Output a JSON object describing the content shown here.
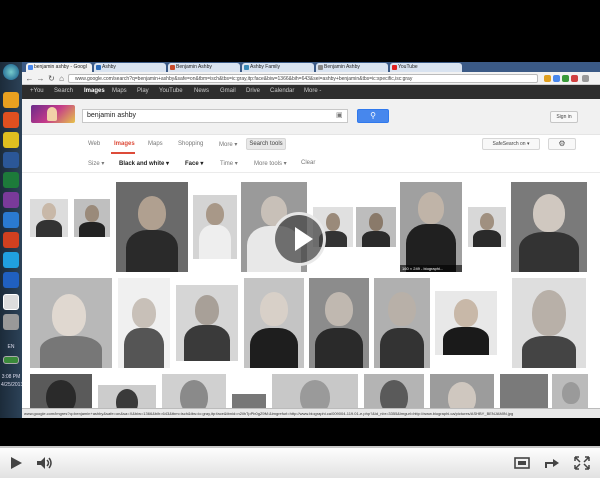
{
  "browser": {
    "tabs": [
      {
        "label": "benjamin ashby - Googl"
      },
      {
        "label": "Ashby"
      },
      {
        "label": "Benjamin Ashby"
      },
      {
        "label": "Ashby Family"
      },
      {
        "label": "Benjamin Ashby"
      },
      {
        "label": "YouTube"
      }
    ],
    "url": "www.google.com/search?q=benjamin+ashby&safe=on&tbm=isch&tbs=ic:gray,itp:face&biw=1366&bih=643&sei=ashby+benjamin&tbs=ic:specific,isc:gray"
  },
  "gbar": {
    "items": [
      "+You",
      "Search",
      "Images",
      "Maps",
      "Play",
      "YouTube",
      "News",
      "Gmail",
      "Drive",
      "Calendar",
      "More -"
    ],
    "active": "Images"
  },
  "search": {
    "query": "benjamin ashby",
    "sign_in": "Sign in"
  },
  "tools": {
    "tabs": [
      "Web",
      "Images",
      "Maps",
      "Shopping",
      "More ▾"
    ],
    "search_tools": "Search tools",
    "safesearch": "SafeSearch on ▾",
    "filters": [
      "Size ▾",
      "Black and white ▾",
      "Face ▾",
      "Time ▾",
      "More tools ▾",
      "Clear"
    ]
  },
  "results": {
    "caption": "160 × 249 - biographi..."
  },
  "statusbar": {
    "text": "www.google.com/imgres?q=benjamin+ashby&safe=on&sa=X&biw=1366&bih=643&tbm=isch&tbs=ic:gray,itp:face&tbnid=n2ilhTpPb0gZ9M:&imgrefurl=http://www.biographi.ca/009004-119.01-e.php?&id_nbr=3355&imgurl=http://www.biographi.ca/pictures/ASHBY_BENJAMIN.jpg"
  },
  "taskbar": {
    "lang": "EN",
    "time": "3:08 PM",
    "date": "4/25/2013"
  },
  "video": {
    "progress": 0.0
  },
  "colors": {
    "accent_red": "#dd4b39",
    "search_blue": "#4787ed",
    "gbar": "#2d2d2d"
  }
}
